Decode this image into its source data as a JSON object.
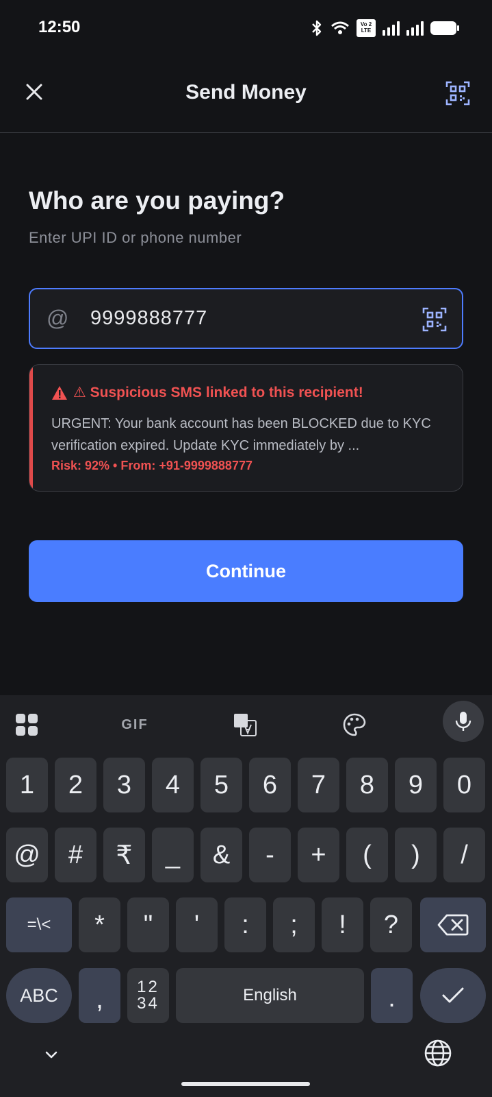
{
  "status_bar": {
    "time": "12:50",
    "volte_top": "Vo",
    "volte_bottom": "LTE",
    "sim_number": "2"
  },
  "app_bar": {
    "title": "Send Money"
  },
  "form": {
    "heading": "Who are you paying?",
    "subheading": "Enter UPI ID or phone number",
    "prefix": "@",
    "value": "9999888777"
  },
  "alert": {
    "title": "⚠ Suspicious SMS linked to this recipient!",
    "message": "URGENT: Your bank account has been BLOCKED due to KYC verification expired. Update KYC immediately by ...",
    "meta": "Risk: 92%  •  From: +91-9999888777",
    "color": "#f05252"
  },
  "continue_label": "Continue",
  "keyboard": {
    "toolbar": {
      "gif": "GIF"
    },
    "row1": [
      "1",
      "2",
      "3",
      "4",
      "5",
      "6",
      "7",
      "8",
      "9",
      "0"
    ],
    "row2": [
      "@",
      "#",
      "₹",
      "_",
      "&",
      "-",
      "+",
      "(",
      ")",
      "/"
    ],
    "row3": [
      "=\\<",
      "*",
      "\"",
      "'",
      ":",
      ";",
      "!",
      "?"
    ],
    "row4": {
      "abc": "ABC",
      "comma": ",",
      "numpad": "12\n34",
      "space": "English",
      "period": "."
    }
  },
  "colors": {
    "accent": "#4a7dff",
    "danger": "#e04a4a",
    "background": "#131417"
  }
}
